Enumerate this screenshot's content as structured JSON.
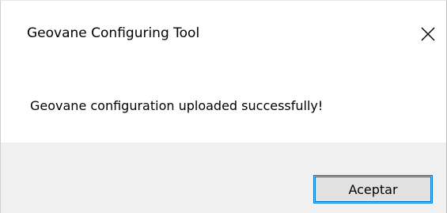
{
  "window": {
    "title": "Geovane Configuring Tool",
    "close_icon": "close-icon"
  },
  "dialog": {
    "message": "Geovane configuration uploaded successfully!",
    "ok_label": "Aceptar"
  },
  "colors": {
    "footer_background": "#f0f0f0",
    "button_background": "#e1e1e1",
    "button_focus_border": "#0078d7"
  }
}
